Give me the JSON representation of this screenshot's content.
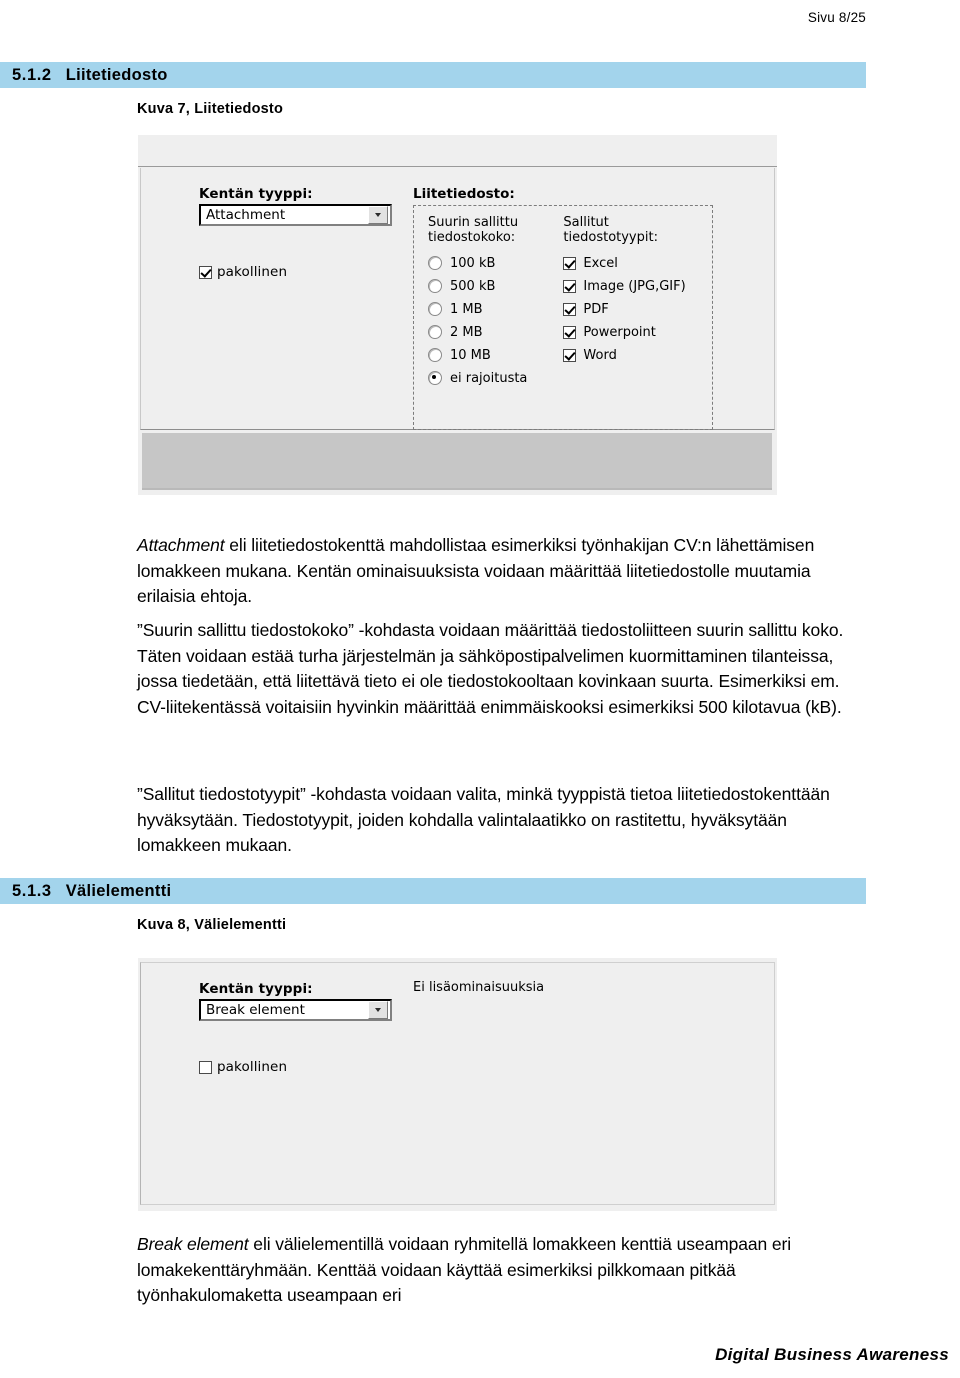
{
  "header": {
    "page_indicator": "Sivu 8/25"
  },
  "footer": {
    "text": "Digital Business Awareness"
  },
  "sections": [
    {
      "number": "5.1.2",
      "title": "Liitetiedosto",
      "figure_caption": "Kuva 7, Liitetiedosto"
    },
    {
      "number": "5.1.3",
      "title": "Välielementti",
      "figure_caption": "Kuva 8, Välielementti"
    }
  ],
  "figure7": {
    "field_type_label": "Kentän tyyppi:",
    "field_type_value": "Attachment",
    "required_label": "pakollinen",
    "required_checked": true,
    "group_title": "Liitetiedosto:",
    "max_size_title": "Suurin sallittu\ntiedostokoko:",
    "allowed_types_title": "Sallitut\ntiedostotyypit:",
    "size_options": [
      {
        "label": "100 kB",
        "selected": false
      },
      {
        "label": "500 kB",
        "selected": false
      },
      {
        "label": "1 MB",
        "selected": false
      },
      {
        "label": "2 MB",
        "selected": false
      },
      {
        "label": "10 MB",
        "selected": false
      },
      {
        "label": "ei rajoitusta",
        "selected": true
      }
    ],
    "type_options": [
      {
        "label": "Excel",
        "checked": true
      },
      {
        "label": "Image (JPG,GIF)",
        "checked": true
      },
      {
        "label": "PDF",
        "checked": true
      },
      {
        "label": "Powerpoint",
        "checked": true
      },
      {
        "label": "Word",
        "checked": true
      }
    ]
  },
  "figure8": {
    "field_type_label": "Kentän tyyppi:",
    "field_type_value": "Break element",
    "required_label": "pakollinen",
    "required_checked": false,
    "no_extra_properties": "Ei lisäominaisuuksia"
  },
  "paragraphs": {
    "p1_lead": "Attachment",
    "p1_rest": " eli liitetiedostokenttä mahdollistaa esimerkiksi työnhakijan CV:n lähettämisen lomakkeen mukana. Kentän ominaisuuksista voidaan määrittää liitetiedostolle muutamia erilaisia ehtoja.",
    "p2": "”Suurin sallittu tiedostokoko” -kohdasta voidaan määrittää tiedostoliitteen suurin sallittu koko. Täten voidaan estää turha järjestelmän ja sähköpostipalvelimen kuormittaminen tilanteissa, jossa tiedetään, että liitettävä tieto ei ole tiedostokooltaan kovinkaan suurta. Esimerkiksi em. CV-liitekentässä voitaisiin hyvinkin määrittää enimmäiskooksi esimerkiksi 500 kilotavua (kB).",
    "p3": "”Sallitut tiedostotyypit” -kohdasta voidaan valita, minkä tyyppistä tietoa liitetiedostokenttään hyväksytään. Tiedostotyypit, joiden kohdalla valintalaatikko on rastitettu, hyväksytään lomakkeen mukaan.",
    "p4_lead": "Break element",
    "p4_rest": " eli välielementillä voidaan ryhmitellä lomakkeen kenttiä useampaan eri lomakekenttäryhmään. Kenttää voidaan käyttää esimerkiksi pilkkomaan pitkää työnhakulomaketta useampaan eri"
  },
  "colors": {
    "heading_bar": "#a3d4ec",
    "screenshot_bg": "#efefef",
    "gray_band": "#c6c6c6"
  }
}
